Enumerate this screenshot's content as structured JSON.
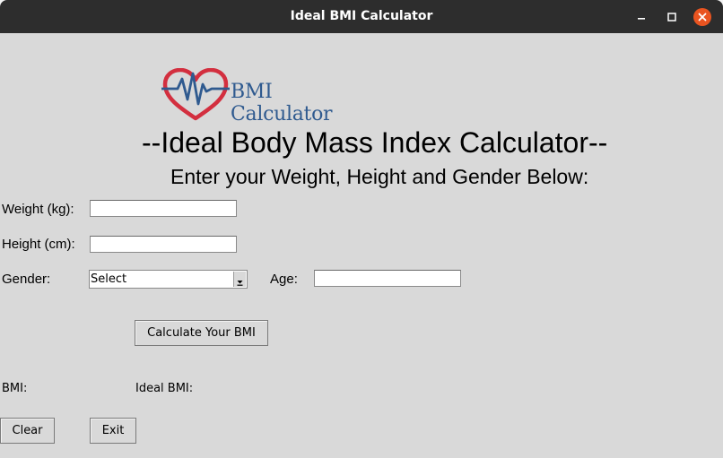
{
  "window": {
    "title": "Ideal BMI Calculator",
    "controls": {
      "minimize": "–",
      "maximize": "□",
      "close": "✕"
    }
  },
  "logo": {
    "text": "BMI Calculator",
    "icon": "heart-pulse-icon"
  },
  "header": {
    "title": "--Ideal Body Mass Index Calculator--",
    "subtitle": "Enter your Weight, Height and Gender Below:"
  },
  "form": {
    "weight_label": "Weight (kg):",
    "weight_value": "",
    "height_label": "Height (cm):",
    "height_value": "",
    "gender_label": "Gender:",
    "gender_selected": "Select",
    "age_label": "Age:",
    "age_value": ""
  },
  "actions": {
    "calculate_label": "Calculate Your BMI",
    "clear_label": "Clear",
    "exit_label": "Exit"
  },
  "results": {
    "bmi_label": "BMI:",
    "ideal_bmi_label": "Ideal BMI:"
  },
  "colors": {
    "titlebar": "#2d2d2d",
    "close_button": "#e95420",
    "background": "#d9d9d9",
    "logo_heart": "#d32f3f",
    "logo_pulse": "#2f5a8f"
  }
}
